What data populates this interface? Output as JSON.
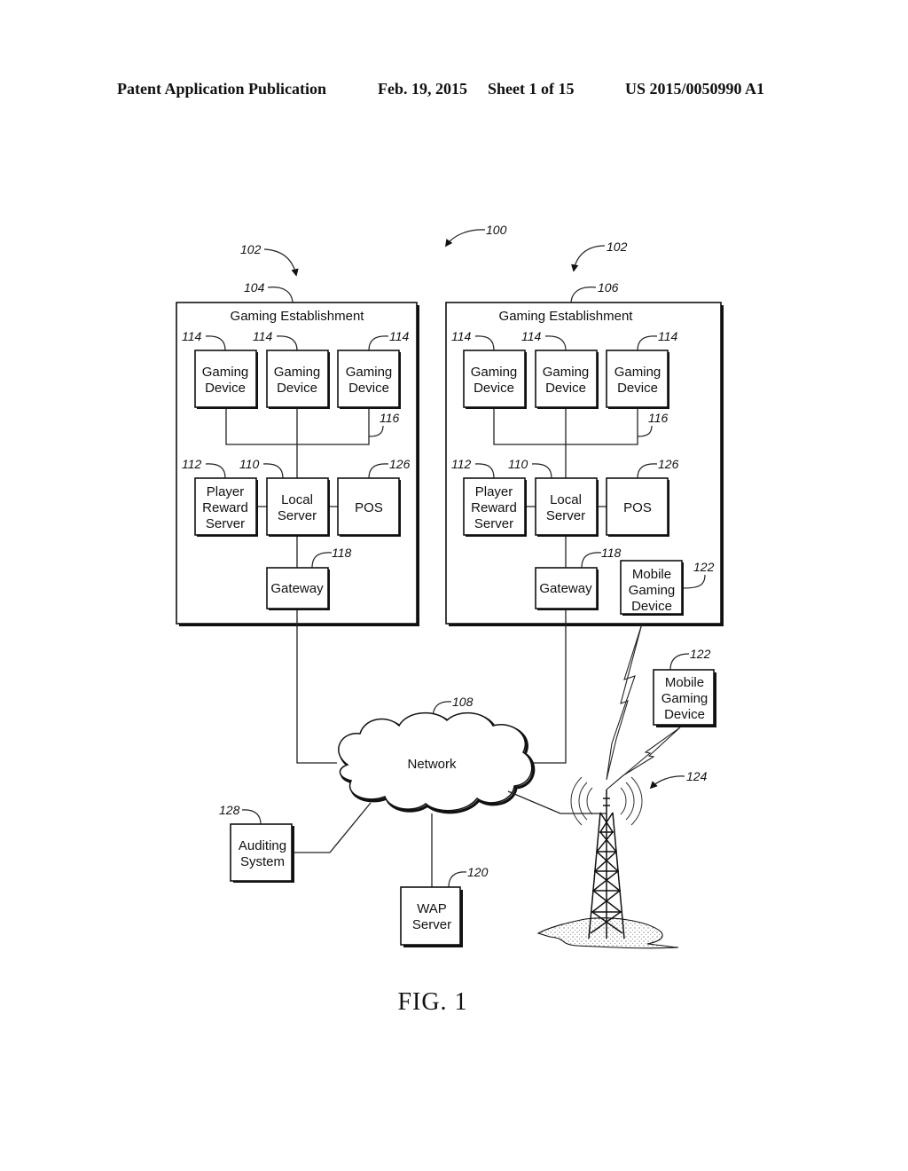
{
  "header": {
    "publication": "Patent Application Publication",
    "date": "Feb. 19, 2015",
    "sheet": "Sheet 1 of 15",
    "number": "US 2015/0050990 A1"
  },
  "figure": {
    "caption": "FIG. 1",
    "system_ref": "100",
    "establishments": [
      {
        "group_ref": "102",
        "ref": "104",
        "title": "Gaming Establishment",
        "gaming_devices": [
          {
            "ref": "114",
            "line1": "Gaming",
            "line2": "Device"
          },
          {
            "ref": "114",
            "line1": "Gaming",
            "line2": "Device"
          },
          {
            "ref": "114",
            "line1": "Gaming",
            "line2": "Device"
          }
        ],
        "bus_ref": "116",
        "player_reward_server": {
          "ref": "112",
          "line1": "Player",
          "line2": "Reward",
          "line3": "Server"
        },
        "local_server": {
          "ref": "110",
          "line1": "Local",
          "line2": "Server"
        },
        "pos": {
          "ref": "126",
          "label": "POS"
        },
        "gateway": {
          "ref": "118",
          "label": "Gateway"
        }
      },
      {
        "group_ref": "102",
        "ref": "106",
        "title": "Gaming Establishment",
        "gaming_devices": [
          {
            "ref": "114",
            "line1": "Gaming",
            "line2": "Device"
          },
          {
            "ref": "114",
            "line1": "Gaming",
            "line2": "Device"
          },
          {
            "ref": "114",
            "line1": "Gaming",
            "line2": "Device"
          }
        ],
        "bus_ref": "116",
        "player_reward_server": {
          "ref": "112",
          "line1": "Player",
          "line2": "Reward",
          "line3": "Server"
        },
        "local_server": {
          "ref": "110",
          "line1": "Local",
          "line2": "Server"
        },
        "pos": {
          "ref": "126",
          "label": "POS"
        },
        "gateway": {
          "ref": "118",
          "label": "Gateway"
        },
        "mobile_gaming_device": {
          "ref": "122",
          "line1": "Mobile",
          "line2": "Gaming",
          "line3": "Device"
        }
      }
    ],
    "network": {
      "ref": "108",
      "label": "Network"
    },
    "external_mobile_device": {
      "ref": "122",
      "line1": "Mobile",
      "line2": "Gaming",
      "line3": "Device"
    },
    "tower": {
      "ref": "124"
    },
    "auditing_system": {
      "ref": "128",
      "line1": "Auditing",
      "line2": "System"
    },
    "wap_server": {
      "ref": "120",
      "line1": "WAP",
      "line2": "Server"
    }
  }
}
